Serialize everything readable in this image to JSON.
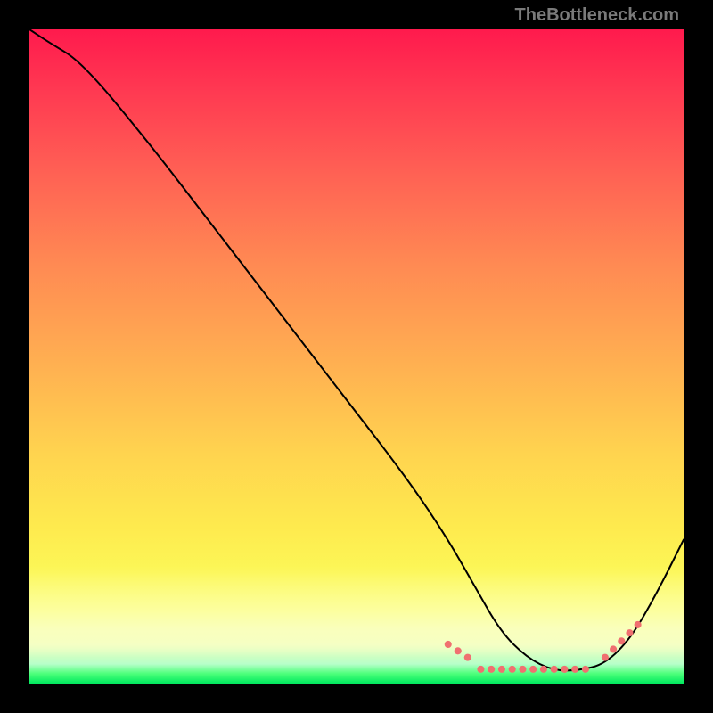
{
  "watermark": "TheBottleneck.com",
  "chart_data": {
    "type": "line",
    "title": "",
    "xlabel": "",
    "ylabel": "",
    "xlim": [
      0,
      100
    ],
    "ylim": [
      0,
      100
    ],
    "series": [
      {
        "name": "bottleneck-curve",
        "x": [
          0,
          3,
          8,
          18,
          28,
          38,
          48,
          58,
          64,
          68,
          72,
          76,
          80,
          84,
          88,
          92,
          96,
          100
        ],
        "values": [
          100,
          98,
          95,
          83,
          70,
          57,
          44,
          31,
          22,
          15,
          8,
          4,
          2,
          2,
          3,
          7,
          14,
          22
        ]
      }
    ],
    "valley_markers": {
      "name": "dotted-salmon-segments",
      "color": "#f07070",
      "segments": [
        {
          "x": [
            64,
            67
          ],
          "y": [
            6,
            4
          ]
        },
        {
          "x": [
            69,
            85
          ],
          "y": [
            2.2,
            2.2
          ]
        },
        {
          "x": [
            88,
            93
          ],
          "y": [
            4,
            9
          ]
        }
      ]
    },
    "background": {
      "type": "vertical-gradient",
      "top": "#ff1a4d",
      "bottom": "#00e85e"
    }
  }
}
